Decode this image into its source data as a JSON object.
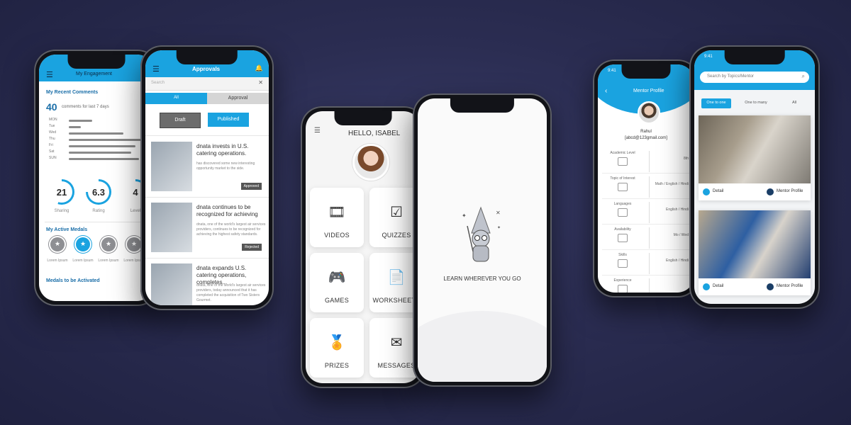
{
  "phone1": {
    "header_title": "My Engagement",
    "section_recent_comments": "My Recent Comments",
    "comment_count": "40",
    "comment_caption": "comments for last 7 days",
    "bars": [
      {
        "label": "MON",
        "value": 0.3
      },
      {
        "label": "Tue",
        "value": 0.15
      },
      {
        "label": "Wed",
        "value": 0.7
      },
      {
        "label": "Thu",
        "value": 0.95
      },
      {
        "label": "Fri",
        "value": 0.85
      },
      {
        "label": "Sat",
        "value": 0.8
      },
      {
        "label": "SUN",
        "value": 0.9
      }
    ],
    "stats": [
      {
        "value": "21",
        "label": "Sharing",
        "fill": 0.55
      },
      {
        "value": "6.3",
        "label": "Rating",
        "fill": 0.75
      },
      {
        "value": "4",
        "label": "Level",
        "fill": 0.35
      }
    ],
    "section_active_medals": "My Active Medals",
    "medals": [
      {
        "label": "Lorem Ipsum",
        "color": "#8e8f93"
      },
      {
        "label": "Lorem Ipsum",
        "color": "#1aa3e0"
      },
      {
        "label": "Lorem Ipsum",
        "color": "#8e8f93"
      },
      {
        "label": "Lorem Ipsum",
        "color": "#8e8f93"
      }
    ],
    "section_to_activate": "Medals to be Activated"
  },
  "phone2": {
    "header_title": "Approvals",
    "search_placeholder": "Search",
    "tabs": [
      "All",
      "Approval"
    ],
    "btn_draft": "Draft",
    "btn_published": "Published",
    "news": [
      {
        "title": "dnata invests in U.S. catering operations.",
        "body": "has discovered some new interesting opportunity market to the side.",
        "badge": "Approved"
      },
      {
        "title": "dnata continues to be recognized for achieving",
        "body": "dnata, one of the world's largest air services providers, continues to be recognized for achieving the highest safety standards.",
        "badge": "Rejected"
      },
      {
        "title": "dnata expands U.S. catering operations, completes...",
        "body": "dnata, one of the world's largest air services providers, today announced that it has completed the acquisition of Two Sisters Gourmet.",
        "badge": ""
      }
    ]
  },
  "phone3": {
    "greeting": "HELLO, ISABEL",
    "tiles": [
      {
        "label": "VIDEOS",
        "icon": "video-icon",
        "glyph": "🎞"
      },
      {
        "label": "QUIZZES",
        "icon": "quiz-icon",
        "glyph": "☑"
      },
      {
        "label": "GAMES",
        "icon": "gamepad-icon",
        "glyph": "🎮"
      },
      {
        "label": "WORKSHEETS",
        "icon": "worksheet-icon",
        "glyph": "📄"
      },
      {
        "label": "PRIZES",
        "icon": "prize-icon",
        "glyph": "🏅"
      },
      {
        "label": "MESSAGES",
        "icon": "envelope-icon",
        "glyph": "✉"
      }
    ]
  },
  "phone4": {
    "tagline": "LEARN WHEREVER YOU GO"
  },
  "phone5": {
    "status_time": "9:41",
    "header_title": "Mentor Profile",
    "name": "Rahul",
    "email": "[abcd@123gmail.com]",
    "rows": [
      {
        "key": "Academic Level",
        "value": "8th"
      },
      {
        "key": "Topic of Interest",
        "value": "Math / English / Hindi"
      },
      {
        "key": "Languages",
        "value": "English / Hindi"
      },
      {
        "key": "Availability",
        "value": "Mo / Wed"
      },
      {
        "key": "Skills",
        "value": "English / Hindi"
      },
      {
        "key": "Experience",
        "value": ""
      }
    ]
  },
  "phone6": {
    "status_time": "9:41",
    "search_placeholder": "Search by Topics/Mentor",
    "filters": [
      "One to one",
      "One to many",
      "All"
    ],
    "cards": [
      {
        "detail": "Detail",
        "profile": "Mentor Profile"
      },
      {
        "detail": "Detail",
        "profile": "Mentor Profile"
      }
    ]
  },
  "colors": {
    "accent": "#1aa3e0",
    "background": "#2b2d52"
  }
}
